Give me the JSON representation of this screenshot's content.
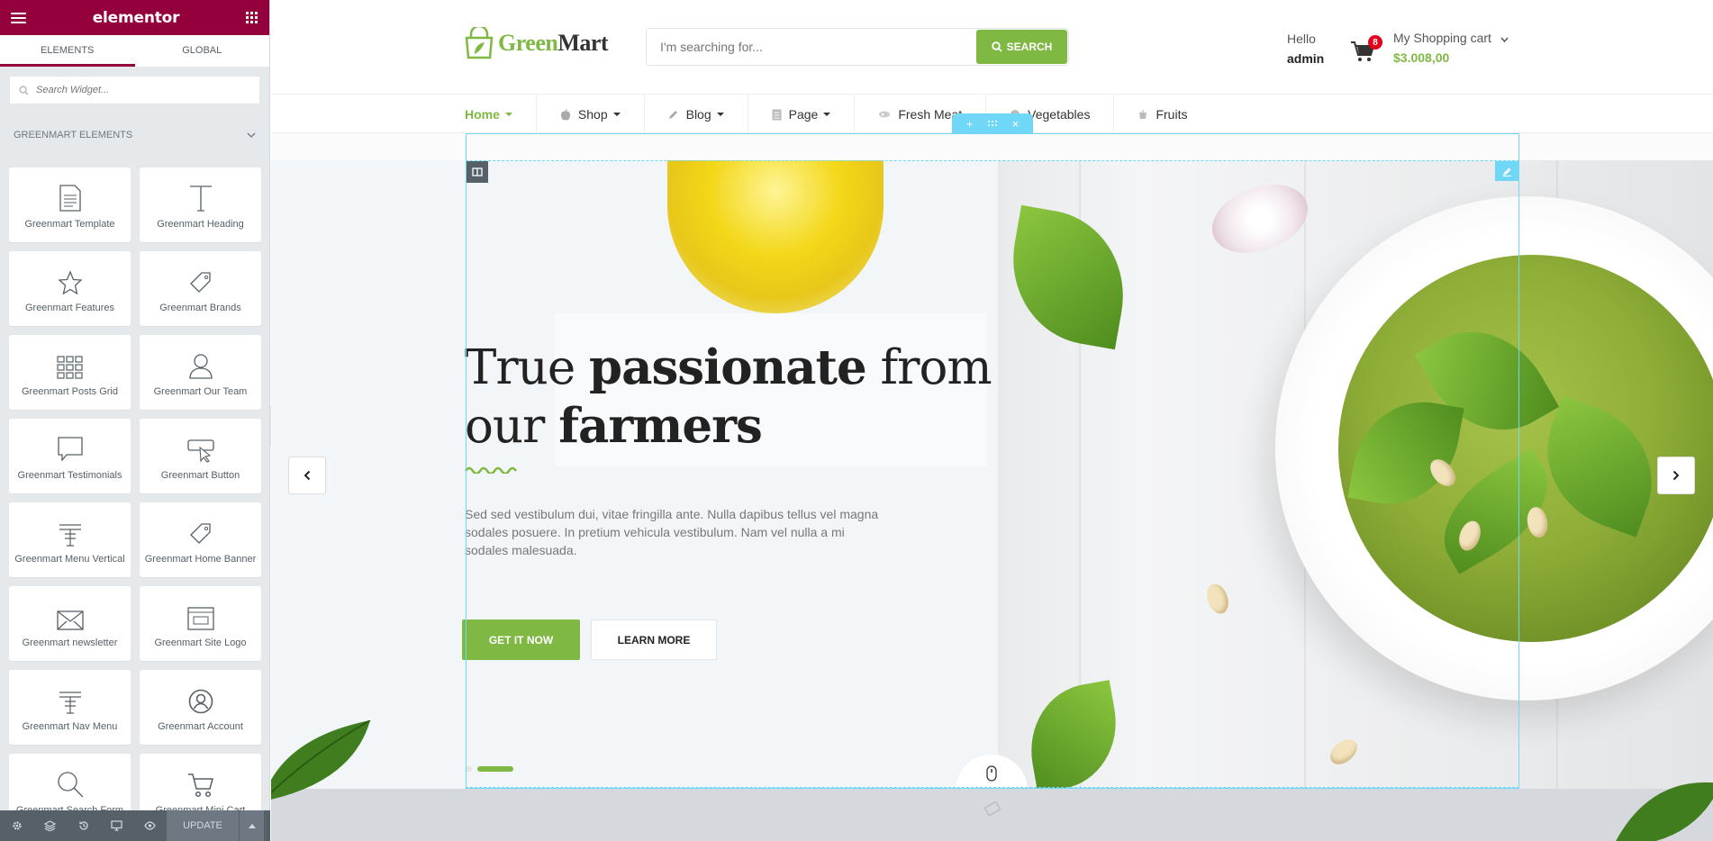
{
  "panel": {
    "brand": "elementor",
    "tabs": [
      "ELEMENTS",
      "GLOBAL"
    ],
    "search_placeholder": "Search Widget...",
    "category": "GREENMART ELEMENTS",
    "widgets": [
      {
        "label": "Greenmart Template",
        "icon": "template-icon"
      },
      {
        "label": "Greenmart Heading",
        "icon": "heading-icon"
      },
      {
        "label": "Greenmart Features",
        "icon": "star-icon"
      },
      {
        "label": "Greenmart Brands",
        "icon": "tag-icon"
      },
      {
        "label": "Greenmart Posts Grid",
        "icon": "posts-grid-icon"
      },
      {
        "label": "Greenmart Our Team",
        "icon": "team-member-icon"
      },
      {
        "label": "Greenmart Testimonials",
        "icon": "testimonial-icon"
      },
      {
        "label": "Greenmart Button",
        "icon": "button-icon"
      },
      {
        "label": "Greenmart Menu Vertical",
        "icon": "menu-icon"
      },
      {
        "label": "Greenmart Home Banner",
        "icon": "tag-icon"
      },
      {
        "label": "Greenmart newsletter",
        "icon": "envelope-icon"
      },
      {
        "label": "Greenmart Site Logo",
        "icon": "site-logo-icon"
      },
      {
        "label": "Greenmart Nav Menu",
        "icon": "menu-icon"
      },
      {
        "label": "Greenmart Account",
        "icon": "user-circle-icon"
      },
      {
        "label": "Greenmart Search Form",
        "icon": "search-icon"
      },
      {
        "label": "Greenmart Mini Cart",
        "icon": "cart-icon"
      }
    ],
    "footer": {
      "update_label": "UPDATE"
    }
  },
  "site": {
    "logo_green": "Green",
    "logo_dark": "Mart",
    "search_placeholder": "I'm searching for...",
    "search_button": "SEARCH",
    "greeting": "Hello",
    "username": "admin",
    "cart_count": "8",
    "cart_label": "My Shopping cart",
    "cart_total": "$3.008,00",
    "nav": [
      {
        "label": "Home",
        "dropdown": true,
        "active": true
      },
      {
        "label": "Shop",
        "dropdown": true
      },
      {
        "label": "Blog",
        "dropdown": true
      },
      {
        "label": "Page",
        "dropdown": true
      },
      {
        "label": "Fresh Meat"
      },
      {
        "label": "Vegetables"
      },
      {
        "label": "Fruits"
      }
    ]
  },
  "hero": {
    "title_part1": "True ",
    "title_bold1": "passionate",
    "title_part2": " from our ",
    "title_bold2": "farmers",
    "description": "Sed sed vestibulum dui, vitae fringilla ante. Nulla dapibus tellus vel magna sodales posuere. In pretium vehicula vestibulum. Nam vel nulla a mi sodales malesuada.",
    "primary_button": "GET IT NOW",
    "secondary_button": "LEARN MORE",
    "slides": 2,
    "active_slide": 2
  },
  "colors": {
    "elementor": "#93003c",
    "accent_green": "#7fb843",
    "editor_blue": "#71d7f7",
    "badge_red": "#e2001a"
  }
}
